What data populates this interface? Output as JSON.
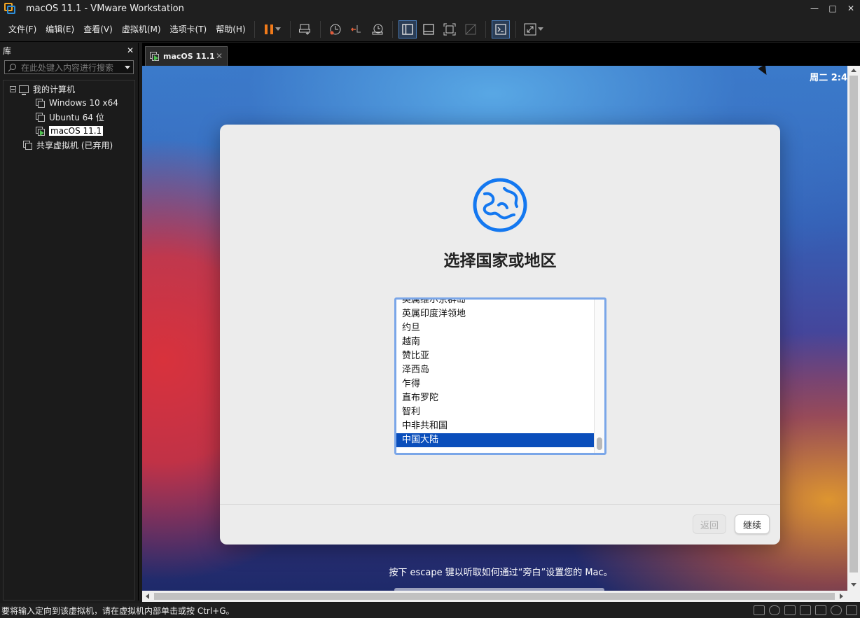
{
  "window": {
    "title": "macOS 11.1 - VMware Workstation",
    "controls": [
      "—",
      "□",
      "✕"
    ]
  },
  "menu": [
    "文件(F)",
    "编辑(E)",
    "查看(V)",
    "虚拟机(M)",
    "选项卡(T)",
    "帮助(H)"
  ],
  "toolbar": {
    "icons": [
      "pause-icon",
      "send-ctrl-alt-del-icon",
      "snapshot-icon",
      "revert-snapshot-icon",
      "snapshot-manager-icon",
      "show-library-icon",
      "thumbnail-bar-icon",
      "fullscreen-icon",
      "unity-icon",
      "console-view-icon",
      "stretch-guest-icon"
    ],
    "accent": "#f07a1a"
  },
  "library": {
    "title": "库",
    "close": "✕",
    "search_placeholder": "在此处键入内容进行搜索",
    "tree": {
      "root": "我的计算机",
      "vms": [
        "Windows 10 x64",
        "Ubuntu 64 位",
        "macOS 11.1"
      ],
      "selected": "macOS 11.1",
      "shared": "共享虚拟机 (已弃用)"
    }
  },
  "tab": {
    "label": "macOS 11.1",
    "close": "✕"
  },
  "guest": {
    "clock": "周二 2:4",
    "dialog": {
      "title": "选择国家或地区",
      "countries": [
        "英属维尔京群岛",
        "英属印度洋领地",
        "约旦",
        "越南",
        "赞比亚",
        "泽西岛",
        "乍得",
        "直布罗陀",
        "智利",
        "中非共和国",
        "中国大陆"
      ],
      "selected": "中国大陆",
      "back_label": "返回",
      "continue_label": "继续"
    },
    "hint": "按下 escape 键以听取如何通过“旁白”设置您的 Mac。"
  },
  "status": {
    "text": "要将输入定向到该虚拟机，请在虚拟机内部单击或按 Ctrl+G。",
    "icons": [
      "hard-disk-icon",
      "cd-dvd-icon",
      "network-icon",
      "sound-icon",
      "printer-icon",
      "display-icon",
      "message-icon"
    ]
  }
}
